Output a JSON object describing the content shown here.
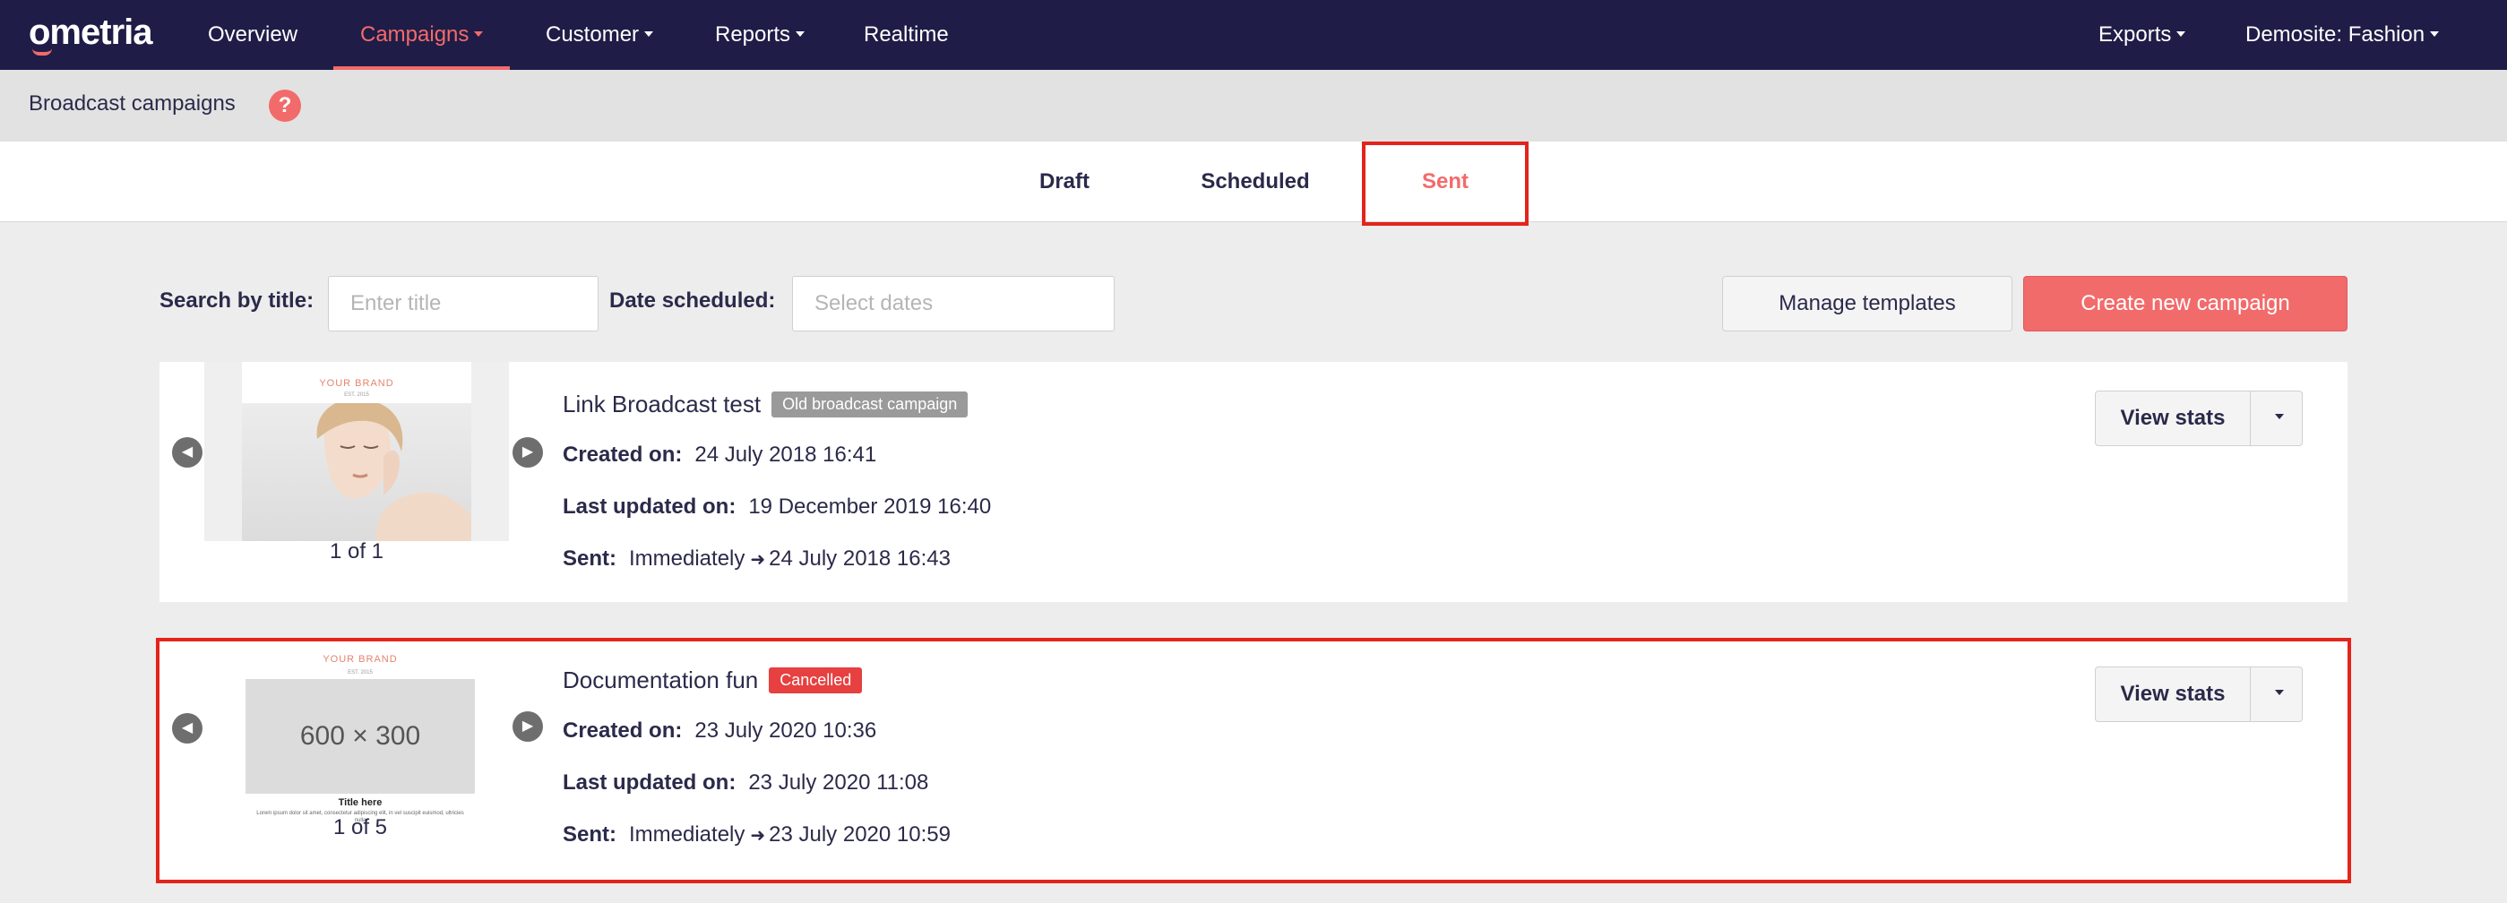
{
  "nav": {
    "logo": "ometria",
    "items": [
      {
        "label": "Overview"
      },
      {
        "label": "Campaigns"
      },
      {
        "label": "Customer"
      },
      {
        "label": "Reports"
      },
      {
        "label": "Realtime"
      }
    ],
    "right": [
      {
        "label": "Exports"
      },
      {
        "label": "Demosite: Fashion"
      }
    ],
    "active_color": "#f26b6b"
  },
  "page": {
    "title": "Broadcast campaigns",
    "help": "?"
  },
  "tabs": [
    {
      "label": "Draft"
    },
    {
      "label": "Scheduled"
    },
    {
      "label": "Sent"
    }
  ],
  "filters": {
    "search_label": "Search by title:",
    "search_placeholder": "Enter title",
    "date_label": "Date scheduled:",
    "date_placeholder": "Select dates"
  },
  "actions": {
    "manage_templates": "Manage templates",
    "create_campaign": "Create new campaign"
  },
  "campaigns": [
    {
      "title": "Link Broadcast test",
      "badge": "Old broadcast campaign",
      "created_label": "Created on:",
      "created": "24 July 2018 16:41",
      "updated_label": "Last updated on:",
      "updated": "19 December 2019 16:40",
      "sent_label": "Sent:",
      "sent_mode": "Immediately",
      "sent_at": "24 July 2018 16:43",
      "pager": "1 of 1",
      "preview": {
        "brand": "YOUR BRAND",
        "small": "EST. 2015"
      },
      "view_stats": "View stats"
    },
    {
      "title": "Documentation fun",
      "badge": "Cancelled",
      "created_label": "Created on:",
      "created": "23 July 2020 10:36",
      "updated_label": "Last updated on:",
      "updated": "23 July 2020 11:08",
      "sent_label": "Sent:",
      "sent_mode": "Immediately",
      "sent_at": "23 July 2020 10:59",
      "pager": "1 of 5",
      "preview": {
        "brand": "YOUR BRAND",
        "small": "EST. 2015",
        "placeholder": "600 × 300",
        "heading": "Title here",
        "body": "Lorem ipsum dolor sit amet, consectetur adipiscing elit, in vel suscipit euismod, ultricies nulla"
      },
      "view_stats": "View stats"
    }
  ]
}
